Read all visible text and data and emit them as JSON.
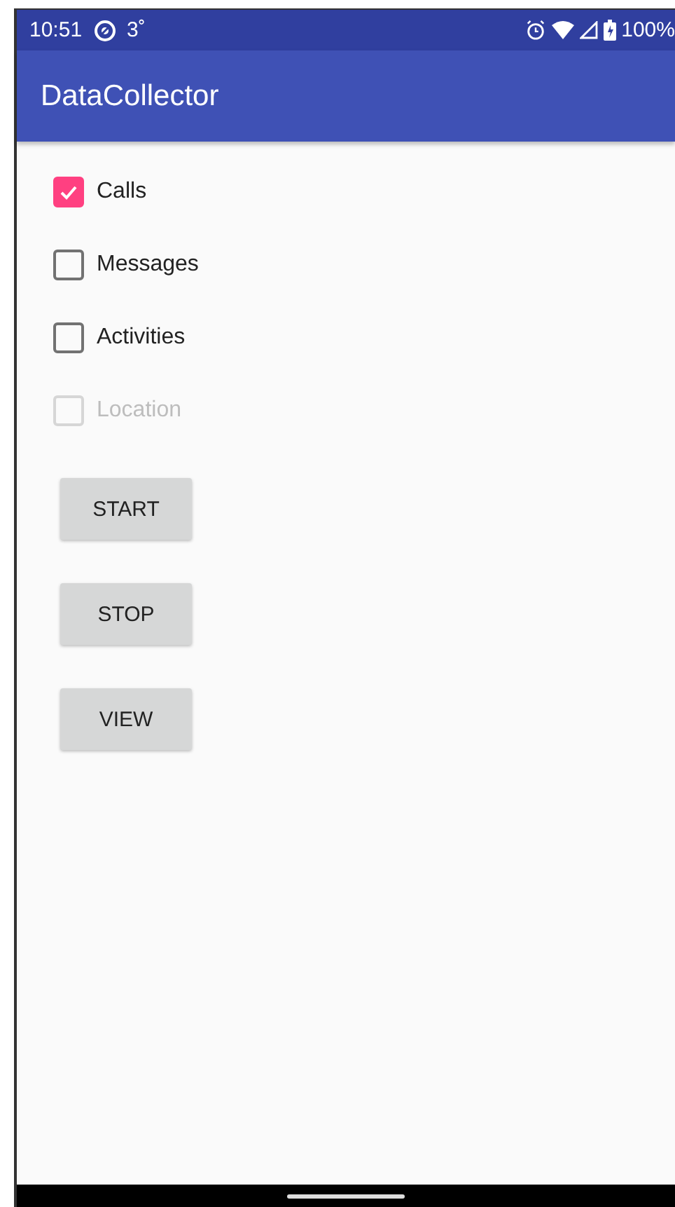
{
  "status_bar": {
    "time": "10:51",
    "temperature": "3˚",
    "battery": "100%"
  },
  "app_bar": {
    "title": "DataCollector"
  },
  "checkboxes": [
    {
      "label": "Calls",
      "checked": true,
      "disabled": false
    },
    {
      "label": "Messages",
      "checked": false,
      "disabled": false
    },
    {
      "label": "Activities",
      "checked": false,
      "disabled": false
    },
    {
      "label": "Location",
      "checked": false,
      "disabled": true
    }
  ],
  "buttons": [
    "START",
    "STOP",
    "VIEW"
  ]
}
